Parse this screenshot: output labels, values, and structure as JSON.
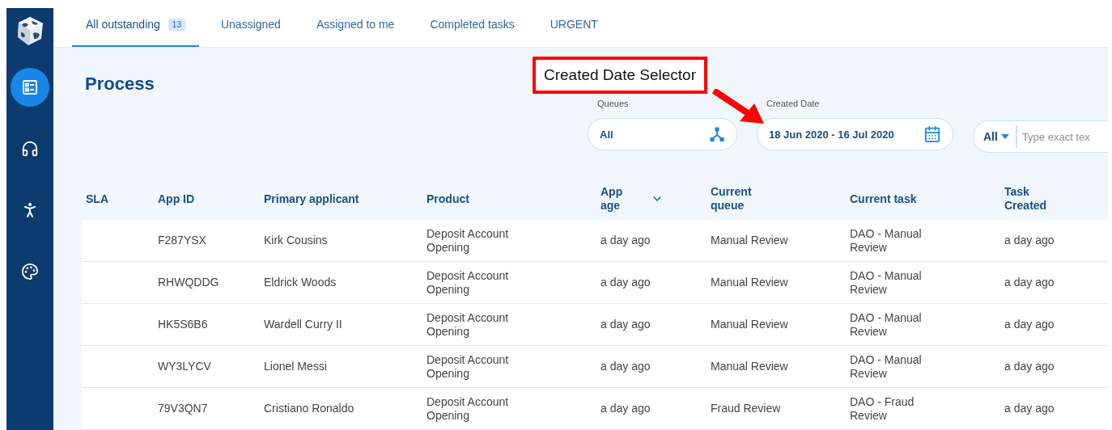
{
  "sidebar": {
    "items": [
      {
        "kind": "list",
        "selected": true
      },
      {
        "kind": "headset",
        "selected": false
      },
      {
        "kind": "accessibility",
        "selected": false
      },
      {
        "kind": "palette",
        "selected": false
      }
    ]
  },
  "tabs": [
    {
      "label": "All outstanding",
      "count": "13",
      "selected": true
    },
    {
      "label": "Unassigned",
      "selected": false
    },
    {
      "label": "Assigned to me",
      "selected": false
    },
    {
      "label": "Completed tasks",
      "selected": false
    },
    {
      "label": "URGENT",
      "selected": false
    }
  ],
  "title": "Process",
  "filters": {
    "queues": {
      "label": "Queues",
      "value": "All"
    },
    "created_date": {
      "label": "Created Date",
      "value": "18 Jun 2020 - 16 Jul 2020"
    },
    "search": {
      "scope": "All",
      "placeholder": "Type exact tex"
    }
  },
  "table": {
    "columns": [
      {
        "label": "SLA",
        "sorted": false
      },
      {
        "label": "App ID",
        "sorted": false
      },
      {
        "label": "Primary applicant",
        "sorted": false
      },
      {
        "label": "Product",
        "sorted": false
      },
      {
        "label": "App age",
        "sorted": true
      },
      {
        "label": "Current queue",
        "sorted": false
      },
      {
        "label": "Current task",
        "sorted": false
      },
      {
        "label": "Task Created",
        "sorted": false
      }
    ],
    "rows": [
      [
        "",
        "F287YSX",
        "Kirk Cousins",
        "Deposit Account Opening",
        "a day ago",
        "Manual Review",
        "DAO - Manual Review",
        "a day ago"
      ],
      [
        "",
        "RHWQDDG",
        "Eldrick Woods",
        "Deposit Account Opening",
        "a day ago",
        "Manual Review",
        "DAO - Manual Review",
        "a day ago"
      ],
      [
        "",
        "HK5S6B6",
        "Wardell Curry II",
        "Deposit Account Opening",
        "a day ago",
        "Manual Review",
        "DAO - Manual Review",
        "a day ago"
      ],
      [
        "",
        "WY3LYCV",
        "Lionel Messi",
        "Deposit Account Opening",
        "a day ago",
        "Manual Review",
        "DAO - Manual Review",
        "a day ago"
      ],
      [
        "",
        "79V3QN7",
        "Cristiano Ronaldo",
        "Deposit Account Opening",
        "a day ago",
        "Fraud Review",
        "DAO - Fraud Review",
        "a day ago"
      ]
    ]
  },
  "annotation": {
    "text": "Created Date Selector"
  }
}
